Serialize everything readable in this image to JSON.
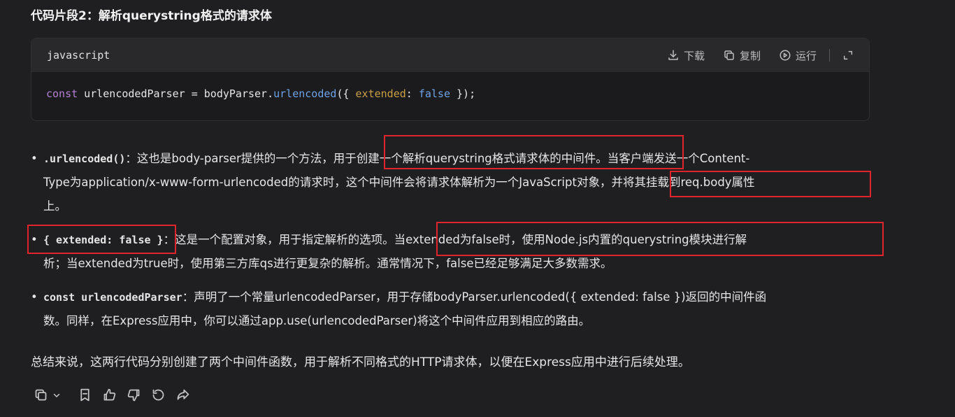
{
  "heading": "代码片段2：解析querystring格式的请求体",
  "code": {
    "language": "javascript",
    "actions": {
      "download": "下载",
      "copy": "复制",
      "run": "运行"
    },
    "tokens": {
      "kw": "const",
      "var": " urlencodedParser = bodyParser.",
      "fn": "urlencoded",
      "open": "({ ",
      "prop": "extended",
      "colon": ": ",
      "bool": "false",
      "close": " });"
    }
  },
  "bullets": [
    {
      "term": ".urlencoded()",
      "line1": "：这也是body-parser提供的一个方法，用于创建一个解析querystring格式请求体的中间件。当客户端发送一个Content-",
      "line2": "Type为application/x-www-form-urlencoded的请求时，这个中间件会将请求体解析为一个JavaScript对象，并将其挂载到req.body属性",
      "line3": "上。"
    },
    {
      "term": "{ extended: false }",
      "line1": "：这是一个配置对象，用于指定解析的选项。当extended为false时，使用Node.js内置的querystring模块进行解",
      "line2": "析；当extended为true时，使用第三方库qs进行更复杂的解析。通常情况下，false已经足够满足大多数需求。"
    },
    {
      "term": "const urlencodedParser",
      "line1": "：声明了一个常量urlencodedParser，用于存储bodyParser.urlencoded({ extended: false })返回的中间件函",
      "line2": "数。同样，在Express应用中，你可以通过app.use(urlencodedParser)将这个中间件应用到相应的路由。"
    }
  ],
  "summary": "总结来说，这两行代码分别创建了两个中间件函数，用于解析不同格式的HTTP请求体，以便在Express应用中进行后续处理。",
  "colors": {
    "background": "#1f1f21",
    "highlight_box": "#e0242c",
    "keyword": "#b381d1",
    "function": "#6fa3e6",
    "property": "#c8a046"
  },
  "footer_icons": [
    "copy-icon",
    "chevron-down-icon",
    "bookmark-icon",
    "thumbs-up-icon",
    "thumbs-down-icon",
    "regenerate-icon",
    "share-icon"
  ]
}
